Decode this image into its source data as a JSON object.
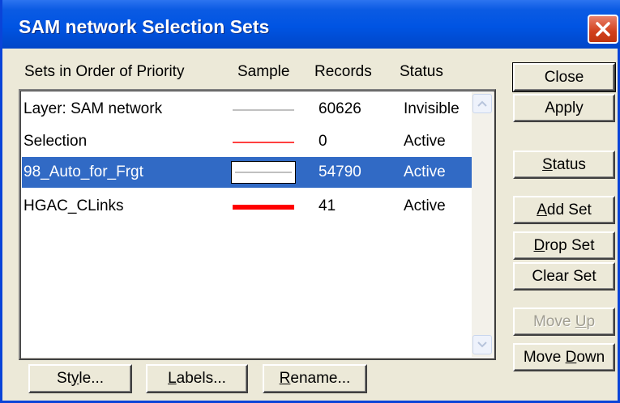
{
  "window": {
    "title": "SAM network Selection Sets"
  },
  "columns": {
    "name": "Sets in Order of Priority",
    "sample": "Sample",
    "records": "Records",
    "status": "Status"
  },
  "rows": [
    {
      "name": "Layer: SAM network",
      "records": "60626",
      "status": "Invisible",
      "line_color": "#808080",
      "line_weight": "thin",
      "selected": false
    },
    {
      "name": "Selection",
      "records": "0",
      "status": "Active",
      "line_color": "#ff0000",
      "line_weight": "thin",
      "selected": false
    },
    {
      "name": "98_Auto_for_Frgt",
      "records": "54790",
      "status": "Active",
      "line_color": "#808080",
      "line_weight": "thin",
      "selected": true
    },
    {
      "name": "HGAC_CLinks",
      "records": "41",
      "status": "Active",
      "line_color": "#ff0000",
      "line_weight": "thick",
      "selected": false
    }
  ],
  "buttons": {
    "close": "Close",
    "apply": "Apply",
    "status_pre": "",
    "status_key": "S",
    "status_post": "tatus",
    "addset_pre": "",
    "addset_key": "A",
    "addset_post": "dd Set",
    "dropset_pre": "",
    "dropset_key": "D",
    "dropset_post": "rop Set",
    "clearset": "Clear Set",
    "moveup_pre": "Move ",
    "moveup_key": "U",
    "moveup_post": "p",
    "movedown_pre": "Move ",
    "movedown_key": "D",
    "movedown_post": "own",
    "style_pre": "St",
    "style_key": "y",
    "style_post": "le...",
    "labels_pre": "",
    "labels_key": "L",
    "labels_post": "abels...",
    "rename_pre": "",
    "rename_key": "R",
    "rename_post": "ename..."
  },
  "icons": {
    "close_window": "close-x-icon",
    "scroll_up": "scroll-up-arrow-icon",
    "scroll_down": "scroll-down-arrow-icon"
  },
  "colors": {
    "titlebar": "#0054e3",
    "selection": "#316ac5",
    "close_button": "#d1401c",
    "dialog_bg": "#ece9d8"
  }
}
